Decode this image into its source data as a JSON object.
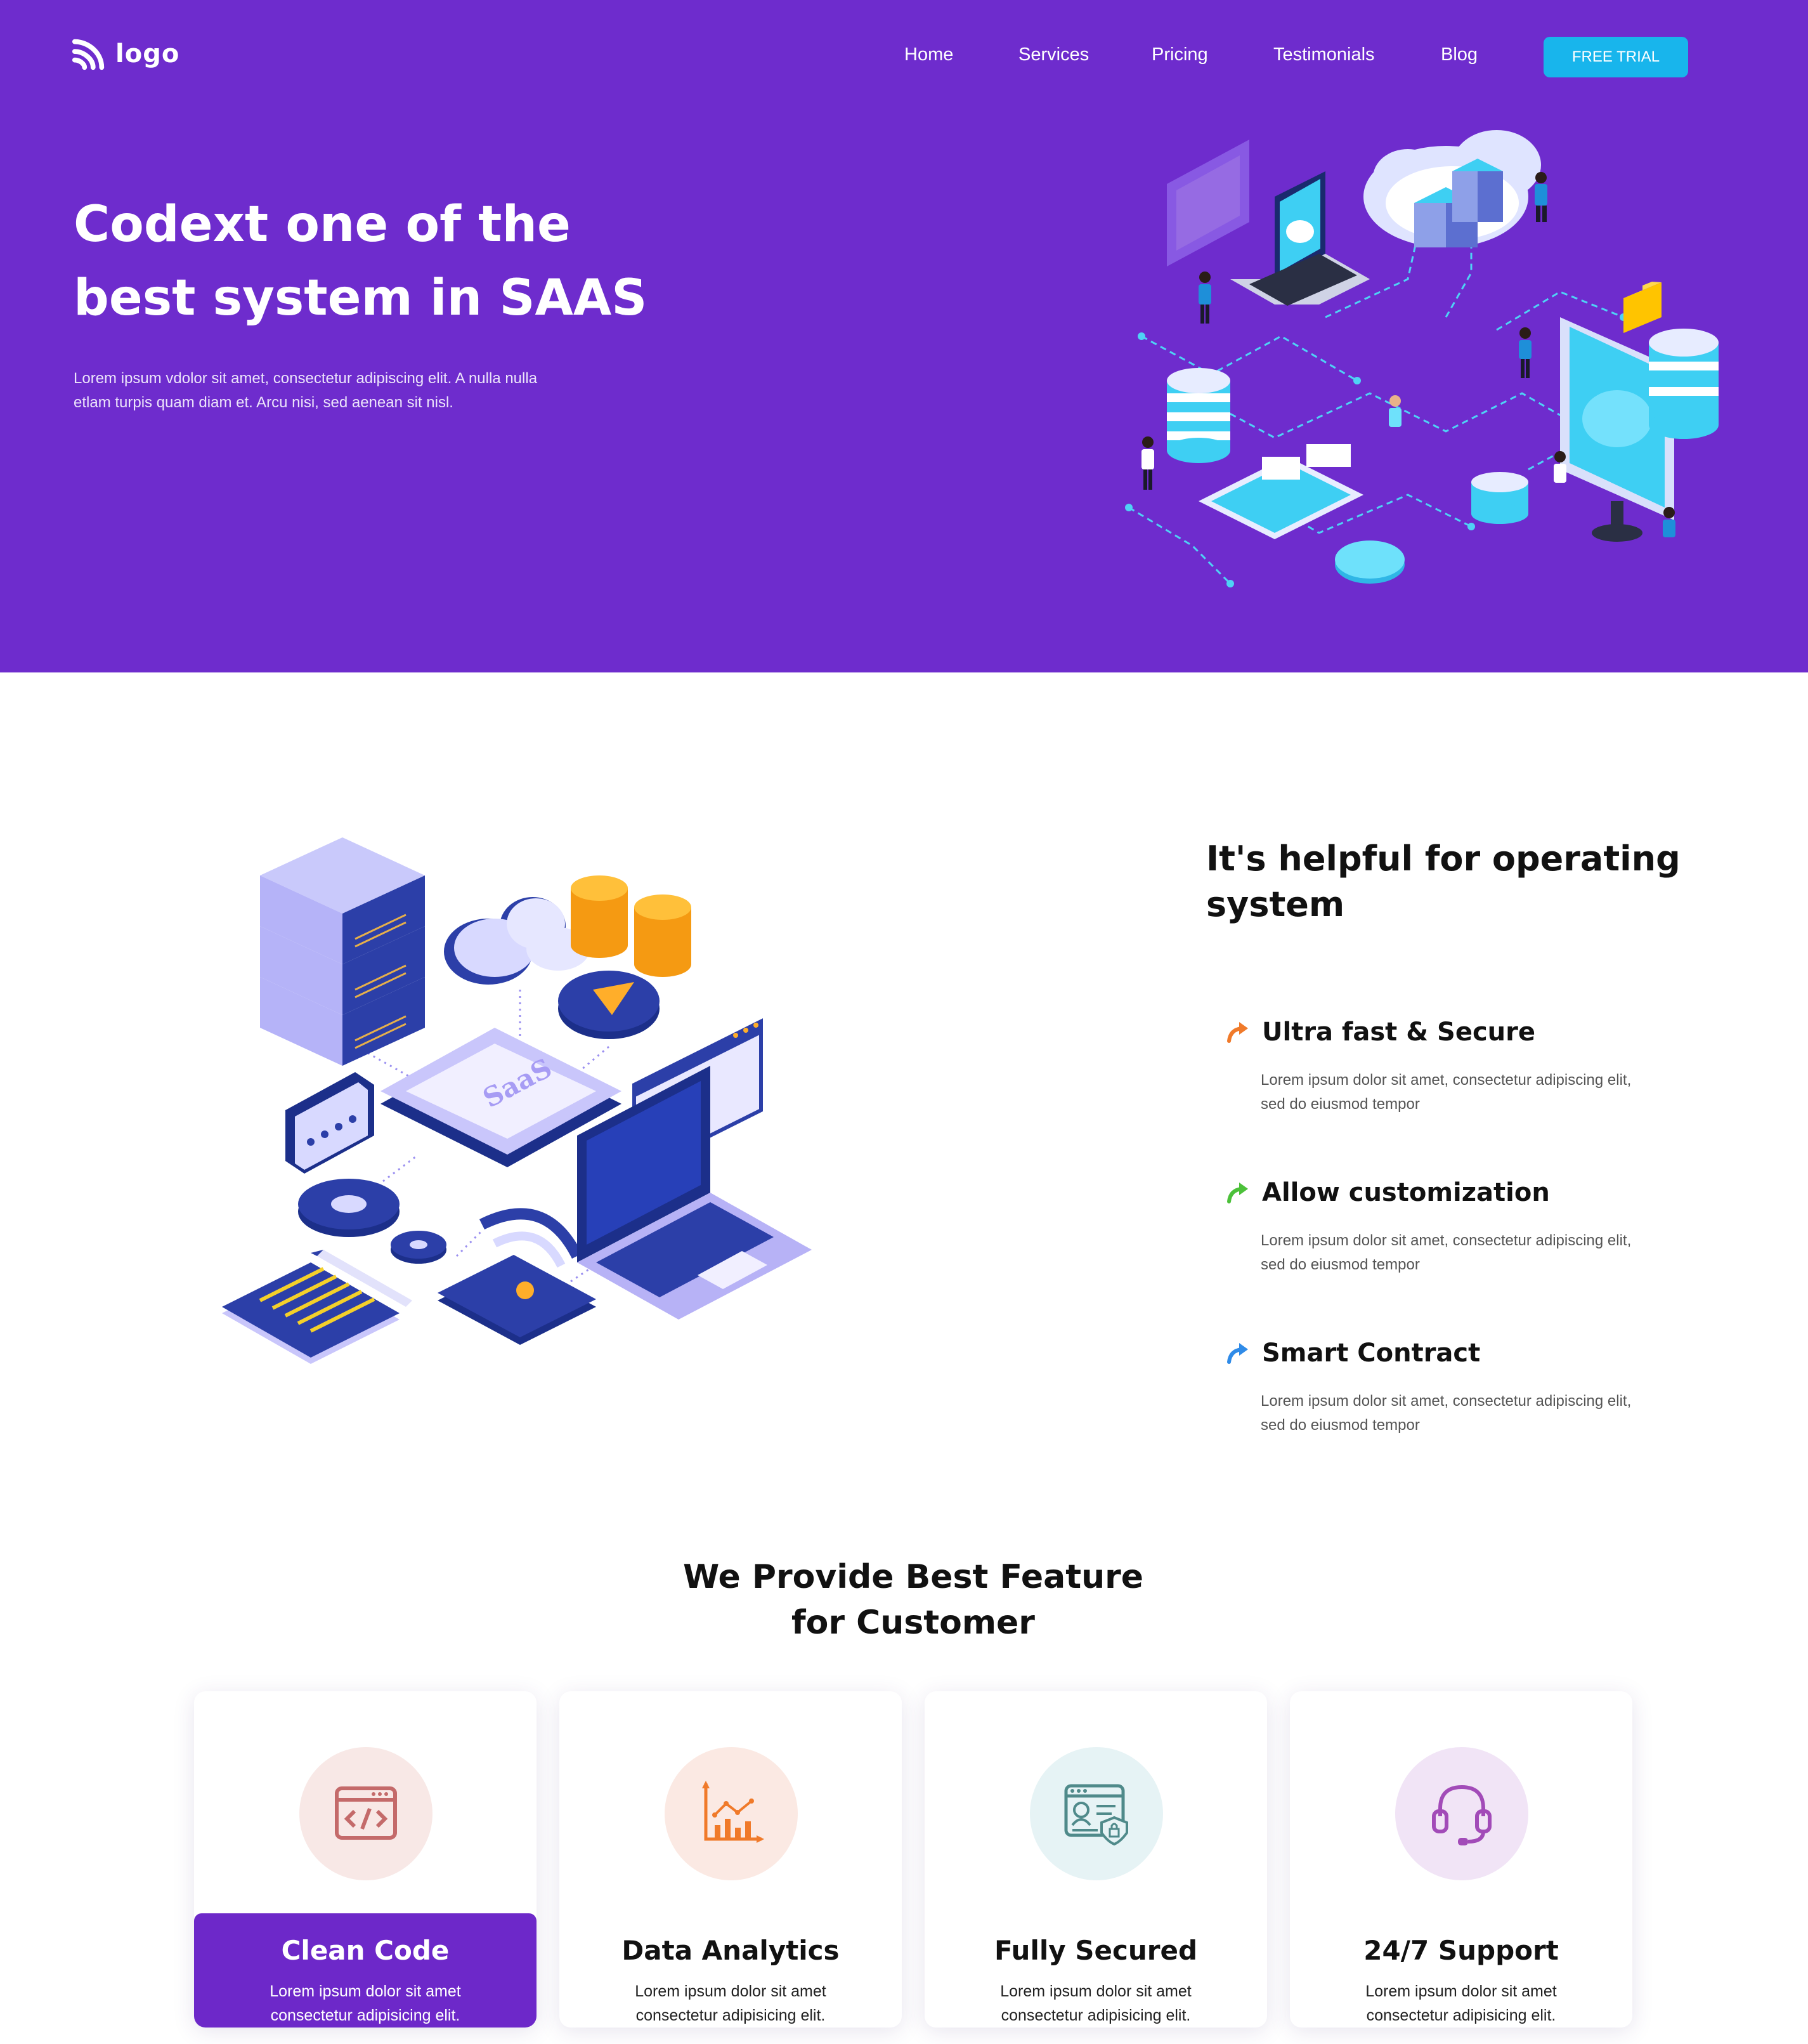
{
  "header": {
    "logo_text": "logo",
    "nav": [
      "Home",
      "Services",
      "Pricing",
      "Testimonials",
      "Blog"
    ],
    "cta_label": "FREE TRIAL"
  },
  "hero": {
    "title_line1": "Codext one of the",
    "title_line2": "best system in SAAS",
    "subtitle": "Lorem ipsum vdolor sit amet, consectetur adipiscing elit. A nulla nulla etlam turpis quam diam et. Arcu nisi, sed aenean sit nisl."
  },
  "about": {
    "title": "It's helpful for operating system",
    "illustration_label": "SaaS",
    "features": [
      {
        "title": "Ultra fast & Secure",
        "desc": "Lorem ipsum dolor sit amet, consectetur adipiscing elit, sed do eiusmod tempor",
        "icon": "arrow-curve-icon",
        "color": "#f07a2a"
      },
      {
        "title": "Allow customization",
        "desc": "Lorem ipsum dolor sit amet, consectetur adipiscing elit, sed do eiusmod tempor",
        "icon": "arrow-curve-icon",
        "color": "#4cc13a"
      },
      {
        "title": "Smart Contract",
        "desc": "Lorem ipsum dolor sit amet, consectetur adipiscing elit, sed do eiusmod tempor",
        "icon": "arrow-curve-icon",
        "color": "#2f8be8"
      }
    ]
  },
  "services": {
    "title_line1": "We Provide Best Feature",
    "title_line2": "for Customer",
    "cards": [
      {
        "title": "Clean Code",
        "desc": "Lorem ipsum dolor sit amet consectetur adipisicing elit.",
        "icon": "code-window-icon",
        "active": true
      },
      {
        "title": "Data Analytics",
        "desc": "Lorem ipsum dolor sit amet consectetur adipisicing elit.",
        "icon": "analytics-chart-icon",
        "active": false
      },
      {
        "title": "Fully Secured",
        "desc": "Lorem ipsum dolor sit amet consectetur adipisicing elit.",
        "icon": "secure-profile-icon",
        "active": false
      },
      {
        "title": "24/7 Support",
        "desc": "Lorem ipsum dolor sit amet consectetur adipisicing elit.",
        "icon": "headset-icon",
        "active": false
      }
    ]
  },
  "colors": {
    "hero_bg": "#6e2ccd",
    "cta_bg": "#18b5ec",
    "active_card_bg": "#6d28c9"
  }
}
